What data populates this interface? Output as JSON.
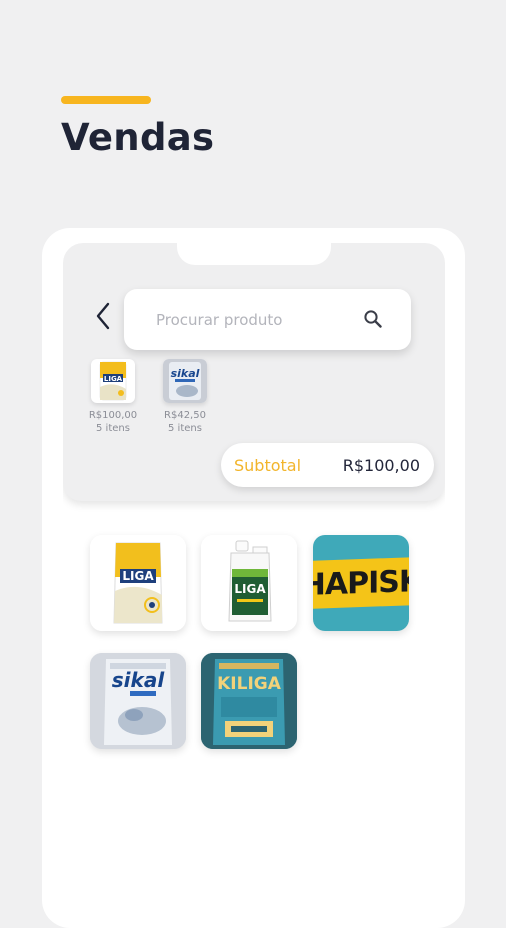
{
  "page": {
    "title": "Vendas",
    "accent_color": "#f7b51f"
  },
  "search": {
    "placeholder": "Procurar produto"
  },
  "cart": {
    "items": [
      {
        "price": "R$100,00",
        "quantity": "5 itens",
        "product": "liga-bag"
      },
      {
        "price": "R$42,50",
        "quantity": "5 itens",
        "product": "sikal-bag"
      }
    ],
    "subtotal_label": "Subtotal",
    "subtotal_value": "R$100,00"
  },
  "products": [
    {
      "name": "liga-bag",
      "brand_text": "LIGA"
    },
    {
      "name": "liga-bottle",
      "brand_text": "LIGA"
    },
    {
      "name": "chapisko",
      "brand_text": "CHAPISKO"
    },
    {
      "name": "sikal-max",
      "brand_text": "sikal"
    },
    {
      "name": "kiliga",
      "brand_text": "KILIGA"
    }
  ],
  "icons": {
    "back": "chevron-left-icon",
    "search": "search-icon"
  }
}
